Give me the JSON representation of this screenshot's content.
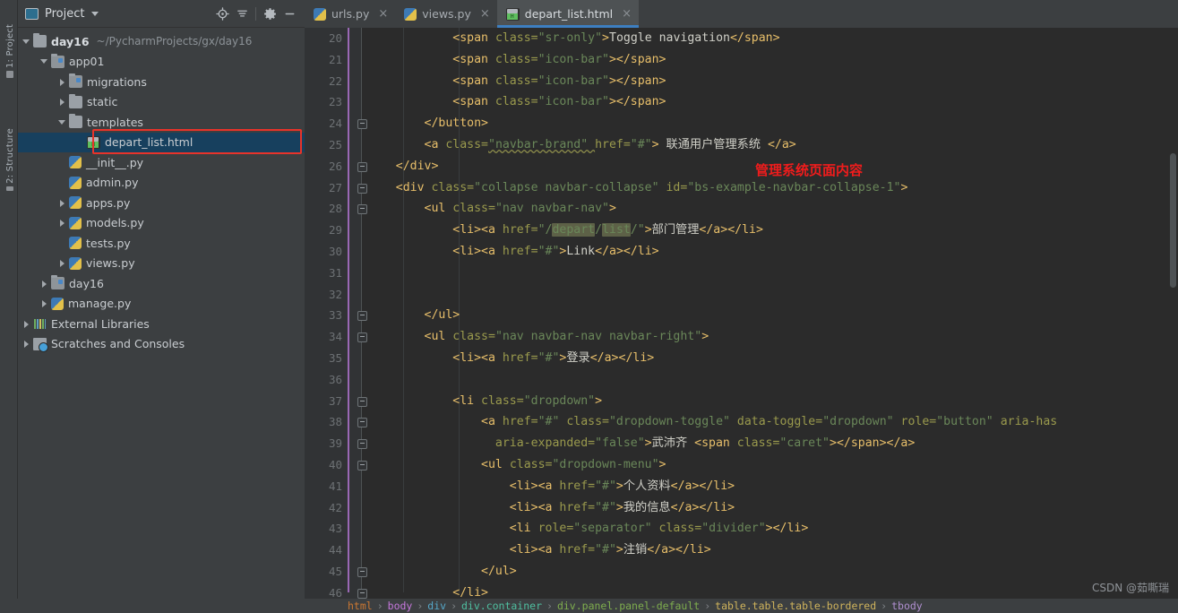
{
  "window": {
    "tool_tabs": [
      {
        "label": "1: Project",
        "icon": "project-icon"
      },
      {
        "label": "2: Structure",
        "icon": "structure-icon"
      }
    ]
  },
  "project_panel": {
    "title": "Project",
    "icons": {
      "panel": "project-icon",
      "caret": "chevron-down-icon",
      "locate": "locate-target-icon",
      "collapse_all": "collapse-all-icon",
      "settings": "gear-icon",
      "minimize": "minimize-icon"
    },
    "tree": [
      {
        "label": "day16",
        "path": "~/PycharmProjects/gx/day16",
        "icon": "folder-icon",
        "state": "open",
        "indent": 0,
        "bold": true
      },
      {
        "label": "app01",
        "path": "",
        "icon": "folder-module-icon",
        "state": "open",
        "indent": 1,
        "bold": false
      },
      {
        "label": "migrations",
        "path": "",
        "icon": "folder-module-icon",
        "state": "closed",
        "indent": 2,
        "bold": false
      },
      {
        "label": "static",
        "path": "",
        "icon": "folder-icon",
        "state": "closed",
        "indent": 2,
        "bold": false
      },
      {
        "label": "templates",
        "path": "",
        "icon": "folder-icon",
        "state": "open",
        "indent": 2,
        "bold": false
      },
      {
        "label": "depart_list.html",
        "path": "",
        "icon": "html-file-icon",
        "state": "leaf",
        "indent": 3,
        "bold": false,
        "selected": true,
        "highlighted": true
      },
      {
        "label": "__init__.py",
        "path": "",
        "icon": "python-file-icon",
        "state": "leaf",
        "indent": 2,
        "bold": false
      },
      {
        "label": "admin.py",
        "path": "",
        "icon": "python-file-icon",
        "state": "leaf",
        "indent": 2,
        "bold": false
      },
      {
        "label": "apps.py",
        "path": "",
        "icon": "python-file-icon",
        "state": "closed",
        "indent": 2,
        "bold": false
      },
      {
        "label": "models.py",
        "path": "",
        "icon": "python-file-icon",
        "state": "closed",
        "indent": 2,
        "bold": false
      },
      {
        "label": "tests.py",
        "path": "",
        "icon": "python-file-icon",
        "state": "leaf",
        "indent": 2,
        "bold": false
      },
      {
        "label": "views.py",
        "path": "",
        "icon": "python-file-icon",
        "state": "closed",
        "indent": 2,
        "bold": false
      },
      {
        "label": "day16",
        "path": "",
        "icon": "folder-module-icon",
        "state": "closed",
        "indent": 1,
        "bold": false
      },
      {
        "label": "manage.py",
        "path": "",
        "icon": "python-file-icon",
        "state": "closed",
        "indent": 1,
        "bold": false
      },
      {
        "label": "External Libraries",
        "path": "",
        "icon": "libraries-icon",
        "state": "closed",
        "indent": 0,
        "bold": false
      },
      {
        "label": "Scratches and Consoles",
        "path": "",
        "icon": "scratches-icon",
        "state": "closed",
        "indent": 0,
        "bold": false
      }
    ]
  },
  "editor": {
    "tabs": [
      {
        "label": "urls.py",
        "icon": "python-file-icon",
        "active": false,
        "close": "×"
      },
      {
        "label": "views.py",
        "icon": "python-file-icon",
        "active": false,
        "close": "×"
      },
      {
        "label": "depart_list.html",
        "icon": "html-file-icon",
        "active": true,
        "close": "×"
      }
    ],
    "first_line_number": 20,
    "lines": [
      {
        "n": 20,
        "fold": false,
        "segments": [
          {
            "t": "    ",
            "c": "plain"
          },
          {
            "t": "        ",
            "c": "plain"
          },
          {
            "t": "<span ",
            "c": "tag"
          },
          {
            "t": "class=",
            "c": "attr"
          },
          {
            "t": "\"sr-only\"",
            "c": "str"
          },
          {
            "t": ">",
            "c": "tag"
          },
          {
            "t": "Toggle navigation",
            "c": "txt"
          },
          {
            "t": "</span>",
            "c": "tag"
          }
        ]
      },
      {
        "n": 21,
        "fold": false,
        "segments": [
          {
            "t": "            ",
            "c": "plain"
          },
          {
            "t": "<span ",
            "c": "tag"
          },
          {
            "t": "class=",
            "c": "attr"
          },
          {
            "t": "\"icon-bar\"",
            "c": "str"
          },
          {
            "t": ">",
            "c": "tag"
          },
          {
            "t": "</span>",
            "c": "tag"
          }
        ]
      },
      {
        "n": 22,
        "fold": false,
        "segments": [
          {
            "t": "            ",
            "c": "plain"
          },
          {
            "t": "<span ",
            "c": "tag"
          },
          {
            "t": "class=",
            "c": "attr"
          },
          {
            "t": "\"icon-bar\"",
            "c": "str"
          },
          {
            "t": ">",
            "c": "tag"
          },
          {
            "t": "</span>",
            "c": "tag"
          }
        ]
      },
      {
        "n": 23,
        "fold": false,
        "segments": [
          {
            "t": "            ",
            "c": "plain"
          },
          {
            "t": "<span ",
            "c": "tag"
          },
          {
            "t": "class=",
            "c": "attr"
          },
          {
            "t": "\"icon-bar\"",
            "c": "str"
          },
          {
            "t": ">",
            "c": "tag"
          },
          {
            "t": "</span>",
            "c": "tag"
          }
        ]
      },
      {
        "n": 24,
        "fold": true,
        "segments": [
          {
            "t": "        ",
            "c": "plain"
          },
          {
            "t": "</button>",
            "c": "tag"
          }
        ]
      },
      {
        "n": 25,
        "fold": false,
        "segments": [
          {
            "t": "        ",
            "c": "plain"
          },
          {
            "t": "<a ",
            "c": "tag"
          },
          {
            "t": "class=",
            "c": "attr"
          },
          {
            "t": "\"navbar-brand\" ",
            "c": "err"
          },
          {
            "t": "href=",
            "c": "attr"
          },
          {
            "t": "\"#\"",
            "c": "str"
          },
          {
            "t": "> ",
            "c": "tag"
          },
          {
            "t": "联通用户管理系统 ",
            "c": "txt"
          },
          {
            "t": "</a>",
            "c": "tag"
          }
        ]
      },
      {
        "n": 26,
        "fold": true,
        "segments": [
          {
            "t": "    ",
            "c": "plain"
          },
          {
            "t": "</div>",
            "c": "tag"
          }
        ]
      },
      {
        "n": 27,
        "fold": true,
        "segments": [
          {
            "t": "    ",
            "c": "plain"
          },
          {
            "t": "<div ",
            "c": "tag"
          },
          {
            "t": "class=",
            "c": "attr"
          },
          {
            "t": "\"collapse navbar-collapse\" ",
            "c": "str"
          },
          {
            "t": "id=",
            "c": "attr"
          },
          {
            "t": "\"bs-example-navbar-collapse-1\"",
            "c": "str"
          },
          {
            "t": ">",
            "c": "tag"
          }
        ]
      },
      {
        "n": 28,
        "fold": true,
        "segments": [
          {
            "t": "        ",
            "c": "plain"
          },
          {
            "t": "<ul ",
            "c": "tag"
          },
          {
            "t": "class=",
            "c": "attr"
          },
          {
            "t": "\"nav navbar-nav\"",
            "c": "str"
          },
          {
            "t": ">",
            "c": "tag"
          }
        ]
      },
      {
        "n": 29,
        "fold": false,
        "segments": [
          {
            "t": "            ",
            "c": "plain"
          },
          {
            "t": "<li>",
            "c": "tag"
          },
          {
            "t": "<a ",
            "c": "tag"
          },
          {
            "t": "href=",
            "c": "attr"
          },
          {
            "t": "\"/",
            "c": "str"
          },
          {
            "t": "depart",
            "c": "str",
            "hl": true
          },
          {
            "t": "/",
            "c": "str"
          },
          {
            "t": "list",
            "c": "str",
            "hl": true
          },
          {
            "t": "/\"",
            "c": "str"
          },
          {
            "t": ">",
            "c": "tag"
          },
          {
            "t": "部门管理",
            "c": "txt"
          },
          {
            "t": "</a>",
            "c": "tag"
          },
          {
            "t": "</li>",
            "c": "tag"
          }
        ]
      },
      {
        "n": 30,
        "fold": false,
        "segments": [
          {
            "t": "            ",
            "c": "plain"
          },
          {
            "t": "<li>",
            "c": "tag"
          },
          {
            "t": "<a ",
            "c": "tag"
          },
          {
            "t": "href=",
            "c": "attr"
          },
          {
            "t": "\"#\"",
            "c": "str"
          },
          {
            "t": ">",
            "c": "tag"
          },
          {
            "t": "Link",
            "c": "txt"
          },
          {
            "t": "</a>",
            "c": "tag"
          },
          {
            "t": "</li>",
            "c": "tag"
          }
        ]
      },
      {
        "n": 31,
        "fold": false,
        "segments": []
      },
      {
        "n": 32,
        "fold": false,
        "segments": []
      },
      {
        "n": 33,
        "fold": true,
        "segments": [
          {
            "t": "        ",
            "c": "plain"
          },
          {
            "t": "</ul>",
            "c": "tag"
          }
        ]
      },
      {
        "n": 34,
        "fold": true,
        "segments": [
          {
            "t": "        ",
            "c": "plain"
          },
          {
            "t": "<ul ",
            "c": "tag"
          },
          {
            "t": "class=",
            "c": "attr"
          },
          {
            "t": "\"nav navbar-nav navbar-right\"",
            "c": "str"
          },
          {
            "t": ">",
            "c": "tag"
          }
        ]
      },
      {
        "n": 35,
        "fold": false,
        "segments": [
          {
            "t": "            ",
            "c": "plain"
          },
          {
            "t": "<li>",
            "c": "tag"
          },
          {
            "t": "<a ",
            "c": "tag"
          },
          {
            "t": "href=",
            "c": "attr"
          },
          {
            "t": "\"#\"",
            "c": "str"
          },
          {
            "t": ">",
            "c": "tag"
          },
          {
            "t": "登录",
            "c": "txt"
          },
          {
            "t": "</a>",
            "c": "tag"
          },
          {
            "t": "</li>",
            "c": "tag"
          }
        ]
      },
      {
        "n": 36,
        "fold": false,
        "segments": []
      },
      {
        "n": 37,
        "fold": true,
        "segments": [
          {
            "t": "            ",
            "c": "plain"
          },
          {
            "t": "<li ",
            "c": "tag"
          },
          {
            "t": "class=",
            "c": "attr"
          },
          {
            "t": "\"dropdown\"",
            "c": "str"
          },
          {
            "t": ">",
            "c": "tag"
          }
        ]
      },
      {
        "n": 38,
        "fold": true,
        "segments": [
          {
            "t": "                ",
            "c": "plain"
          },
          {
            "t": "<a ",
            "c": "tag"
          },
          {
            "t": "href=",
            "c": "attr"
          },
          {
            "t": "\"#\" ",
            "c": "str"
          },
          {
            "t": "class=",
            "c": "attr"
          },
          {
            "t": "\"dropdown-toggle\" ",
            "c": "str"
          },
          {
            "t": "data-toggle=",
            "c": "attr"
          },
          {
            "t": "\"dropdown\" ",
            "c": "str"
          },
          {
            "t": "role=",
            "c": "attr"
          },
          {
            "t": "\"button\" ",
            "c": "str"
          },
          {
            "t": "aria-has",
            "c": "attr"
          }
        ]
      },
      {
        "n": 39,
        "fold": true,
        "segments": [
          {
            "t": "                  ",
            "c": "plain"
          },
          {
            "t": "aria-expanded=",
            "c": "attr"
          },
          {
            "t": "\"false\"",
            "c": "str"
          },
          {
            "t": ">",
            "c": "tag"
          },
          {
            "t": "武沛齐 ",
            "c": "txt"
          },
          {
            "t": "<span ",
            "c": "tag"
          },
          {
            "t": "class=",
            "c": "attr"
          },
          {
            "t": "\"caret\"",
            "c": "str"
          },
          {
            "t": ">",
            "c": "tag"
          },
          {
            "t": "</span>",
            "c": "tag"
          },
          {
            "t": "</a>",
            "c": "tag"
          }
        ]
      },
      {
        "n": 40,
        "fold": true,
        "segments": [
          {
            "t": "                ",
            "c": "plain"
          },
          {
            "t": "<ul ",
            "c": "tag"
          },
          {
            "t": "class=",
            "c": "attr"
          },
          {
            "t": "\"dropdown-menu\"",
            "c": "str"
          },
          {
            "t": ">",
            "c": "tag"
          }
        ]
      },
      {
        "n": 41,
        "fold": false,
        "segments": [
          {
            "t": "                    ",
            "c": "plain"
          },
          {
            "t": "<li>",
            "c": "tag"
          },
          {
            "t": "<a ",
            "c": "tag"
          },
          {
            "t": "href=",
            "c": "attr"
          },
          {
            "t": "\"#\"",
            "c": "str"
          },
          {
            "t": ">",
            "c": "tag"
          },
          {
            "t": "个人资料",
            "c": "txt"
          },
          {
            "t": "</a>",
            "c": "tag"
          },
          {
            "t": "</li>",
            "c": "tag"
          }
        ]
      },
      {
        "n": 42,
        "fold": false,
        "segments": [
          {
            "t": "                    ",
            "c": "plain"
          },
          {
            "t": "<li>",
            "c": "tag"
          },
          {
            "t": "<a ",
            "c": "tag"
          },
          {
            "t": "href=",
            "c": "attr"
          },
          {
            "t": "\"#\"",
            "c": "str"
          },
          {
            "t": ">",
            "c": "tag"
          },
          {
            "t": "我的信息",
            "c": "txt"
          },
          {
            "t": "</a>",
            "c": "tag"
          },
          {
            "t": "</li>",
            "c": "tag"
          }
        ]
      },
      {
        "n": 43,
        "fold": false,
        "segments": [
          {
            "t": "                    ",
            "c": "plain"
          },
          {
            "t": "<li ",
            "c": "tag"
          },
          {
            "t": "role=",
            "c": "attr"
          },
          {
            "t": "\"separator\" ",
            "c": "str"
          },
          {
            "t": "class=",
            "c": "attr"
          },
          {
            "t": "\"divider\"",
            "c": "str"
          },
          {
            "t": ">",
            "c": "tag"
          },
          {
            "t": "</li>",
            "c": "tag"
          }
        ]
      },
      {
        "n": 44,
        "fold": false,
        "segments": [
          {
            "t": "                    ",
            "c": "plain"
          },
          {
            "t": "<li>",
            "c": "tag"
          },
          {
            "t": "<a ",
            "c": "tag"
          },
          {
            "t": "href=",
            "c": "attr"
          },
          {
            "t": "\"#\"",
            "c": "str"
          },
          {
            "t": ">",
            "c": "tag"
          },
          {
            "t": "注销",
            "c": "txt"
          },
          {
            "t": "</a>",
            "c": "tag"
          },
          {
            "t": "</li>",
            "c": "tag"
          }
        ]
      },
      {
        "n": 45,
        "fold": true,
        "segments": [
          {
            "t": "                ",
            "c": "plain"
          },
          {
            "t": "</ul>",
            "c": "tag"
          }
        ]
      },
      {
        "n": 46,
        "fold": true,
        "segments": [
          {
            "t": "            ",
            "c": "plain"
          },
          {
            "t": "</li>",
            "c": "tag"
          }
        ]
      }
    ],
    "annotation": "管理系统页面内容",
    "annotation_color": "#f01c1c"
  },
  "breadcrumb": [
    {
      "label": "html",
      "color": "#cc7832"
    },
    {
      "label": "body",
      "color": "#c678dd"
    },
    {
      "label": "div",
      "color": "#56a8c9"
    },
    {
      "label": "div.container",
      "color": "#4fbfa0"
    },
    {
      "label": "div.panel.panel-default",
      "color": "#7fae4e"
    },
    {
      "label": "table.table.table-bordered",
      "color": "#d0b45c"
    },
    {
      "label": "tbody",
      "color": "#b08fd0"
    }
  ],
  "breadcrumb_separator": "›",
  "watermark": "CSDN @茹嘶瑞",
  "colors": {
    "editor_bg": "#2b2b2b",
    "panel_bg": "#3c3f41",
    "gutter_bg": "#313335",
    "selection": "#17405e",
    "accent_tab": "#3d7fc1",
    "change_marker": "#9a68b5",
    "annotation_red": "#f01c1c",
    "highlight_box": "#e8332a"
  }
}
